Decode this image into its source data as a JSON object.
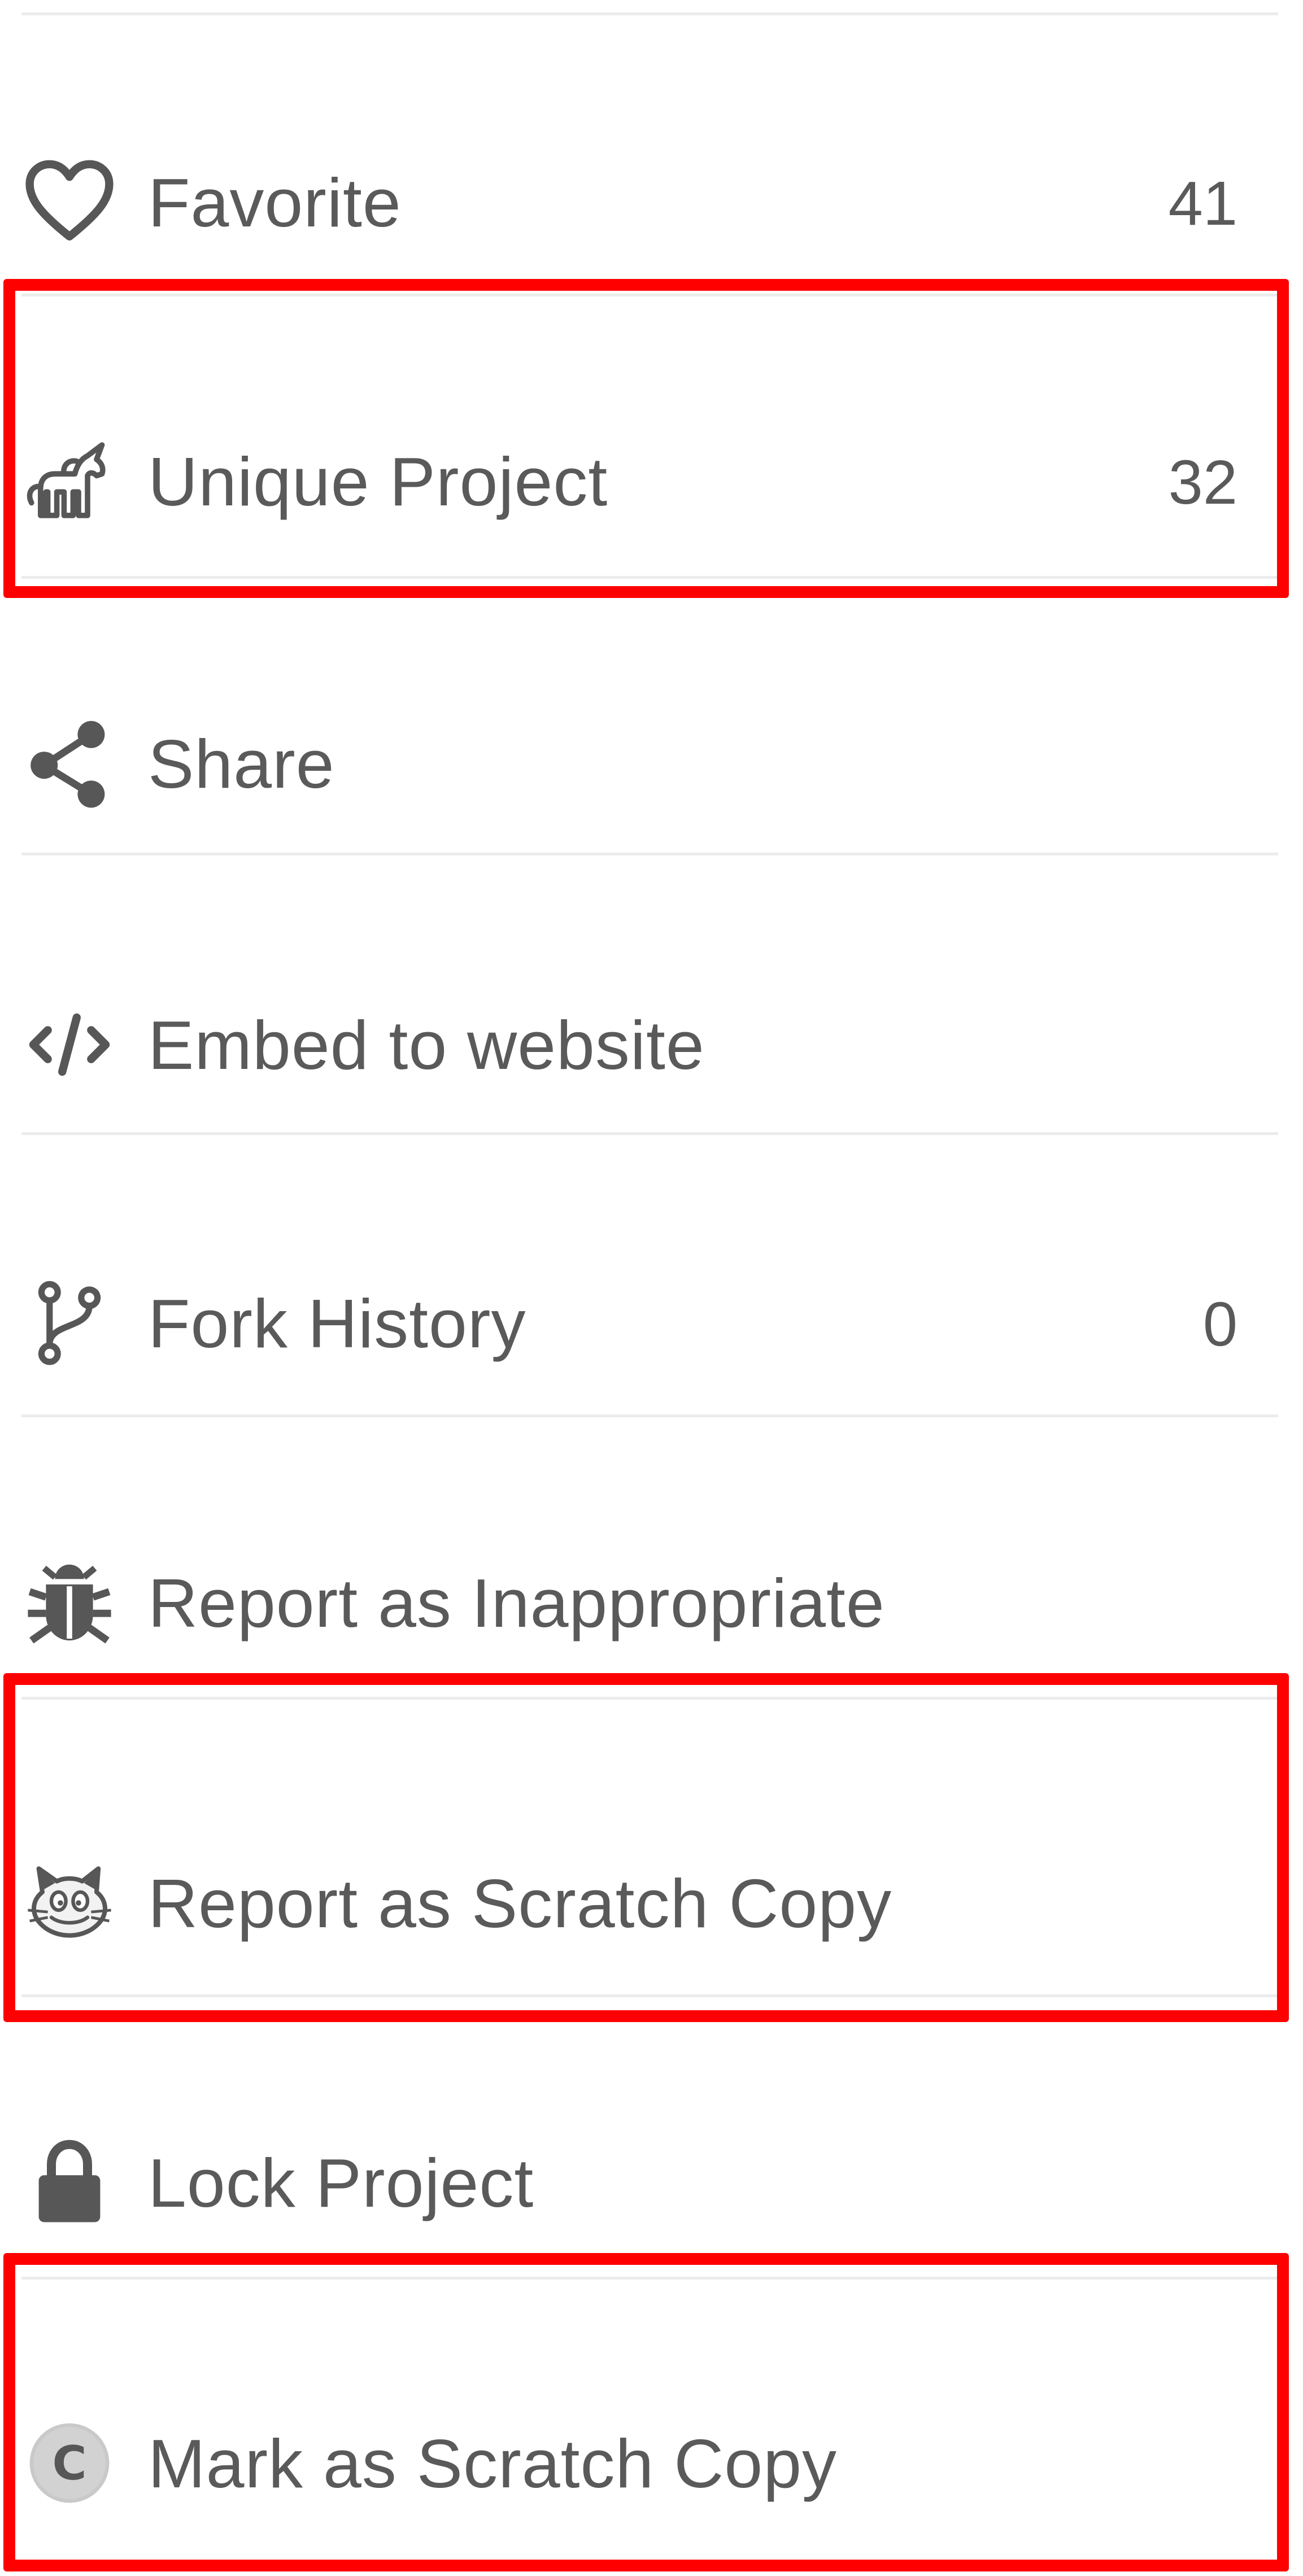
{
  "menu": {
    "items": [
      {
        "key": "favorite",
        "label": "Favorite",
        "count": "41",
        "icon": "heart-outline-icon"
      },
      {
        "key": "unique",
        "label": "Unique Project",
        "count": "32",
        "icon": "unicorn-icon"
      },
      {
        "key": "share",
        "label": "Share",
        "count": "",
        "icon": "share-icon"
      },
      {
        "key": "embed",
        "label": "Embed to website",
        "count": "",
        "icon": "code-icon"
      },
      {
        "key": "fork",
        "label": "Fork History",
        "count": "0",
        "icon": "fork-icon"
      },
      {
        "key": "report-inappropriate",
        "label": "Report as Inappropriate",
        "count": "",
        "icon": "bug-icon"
      },
      {
        "key": "report-scratch",
        "label": "Report as Scratch Copy",
        "count": "",
        "icon": "scratch-cat-icon"
      },
      {
        "key": "lock",
        "label": "Lock Project",
        "count": "",
        "icon": "lock-icon"
      },
      {
        "key": "mark-scratch",
        "label": "Mark as Scratch Copy",
        "count": "",
        "icon": "copyright-c-icon"
      }
    ]
  },
  "annotation_color": "#ff0000",
  "text_color": "#575757"
}
